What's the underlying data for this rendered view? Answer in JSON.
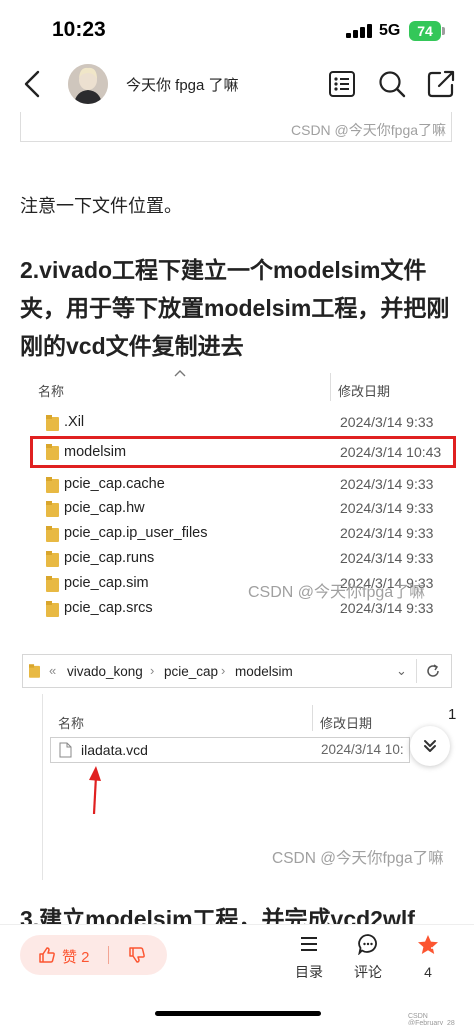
{
  "status_bar": {
    "time": "10:23",
    "network": "5G",
    "battery": "74"
  },
  "header": {
    "author": "今天你 fpga 了嘛"
  },
  "article": {
    "watermark": "CSDN @今天你fpga了嘛",
    "para_location": "注意一下文件位置。",
    "heading2": "2.vivado工程下建立一个modelsim文件夹，用于等下放置modelsim工程，并把刚刚的vcd文件复制进去",
    "explorer1": {
      "col_name": "名称",
      "col_date": "修改日期",
      "rows": [
        {
          "name": ".Xil",
          "date": "2024/3/14 9:33"
        },
        {
          "name": "modelsim",
          "date": "2024/3/14 10:43"
        },
        {
          "name": "pcie_cap.cache",
          "date": "2024/3/14 9:33"
        },
        {
          "name": "pcie_cap.hw",
          "date": "2024/3/14 9:33"
        },
        {
          "name": "pcie_cap.ip_user_files",
          "date": "2024/3/14 9:33"
        },
        {
          "name": "pcie_cap.runs",
          "date": "2024/3/14 9:33"
        },
        {
          "name": "pcie_cap.sim",
          "date": "2024/3/14 9:33"
        },
        {
          "name": "pcie_cap.srcs",
          "date": "2024/3/14 9:33"
        }
      ]
    },
    "explorer2": {
      "breadcrumb": [
        "vivado_kong",
        "pcie_cap",
        "modelsim"
      ],
      "col_name": "名称",
      "col_date": "修改日期",
      "file_name": "iladata.vcd",
      "file_date": "2024/3/14 10:",
      "side_number": "1"
    },
    "heading3": "3.建立modelsim工程，并完成vcd2wlf"
  },
  "bottom_bar": {
    "like_label": "赞 2",
    "toc_label": "目录",
    "comment_label": "评论",
    "fav_count": "4"
  },
  "footer_watermark": "CSDN @February_28",
  "colors": {
    "highlight": "#e02020",
    "accent": "#fc5531",
    "folder": "#e8b943",
    "pill": "#fde9e6"
  }
}
